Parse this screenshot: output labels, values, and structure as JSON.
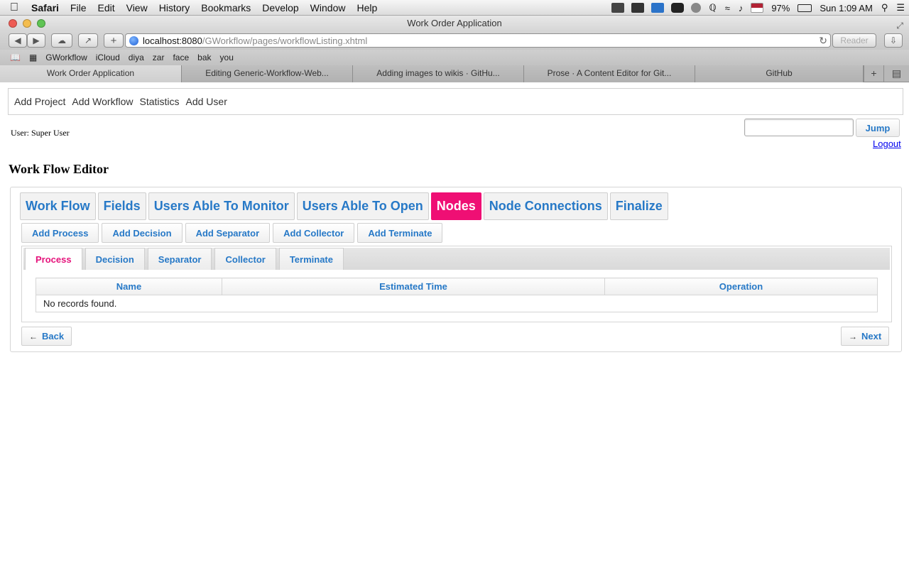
{
  "menubar": {
    "app": "Safari",
    "items": [
      "File",
      "Edit",
      "View",
      "History",
      "Bookmarks",
      "Develop",
      "Window",
      "Help"
    ],
    "battery": "97%",
    "clock": "Sun 1:09 AM"
  },
  "window": {
    "title": "Work Order Application"
  },
  "url": {
    "host": "localhost:8080",
    "path": "/GWorkflow/pages/workflowListing.xhtml",
    "reader": "Reader"
  },
  "bookmarks": [
    "GWorkflow",
    "iCloud",
    "diya",
    "zar",
    "face",
    "bak",
    "you"
  ],
  "tabs": [
    "Work Order Application",
    "Editing Generic-Workflow-Web...",
    "Adding images to wikis · GitHu...",
    "Prose · A Content Editor for Git...",
    "GitHub"
  ],
  "topmenu": [
    "Add Project",
    "Add Workflow",
    "Statistics",
    "Add User"
  ],
  "user_label": "User: Super User",
  "jump_label": "Jump",
  "logout_label": "Logout",
  "page_title": "Work Flow Editor",
  "steps": [
    "Work Flow",
    "Fields",
    "Users Able To Monitor",
    "Users Able To Open",
    "Nodes",
    "Node Connections",
    "Finalize"
  ],
  "actions": [
    "Add Process",
    "Add Decision",
    "Add Separator",
    "Add Collector",
    "Add Terminate"
  ],
  "node_tabs": [
    "Process",
    "Decision",
    "Separator",
    "Collector",
    "Terminate"
  ],
  "table": {
    "columns": [
      "Name",
      "Estimated Time",
      "Operation"
    ],
    "empty_message": "No records found."
  },
  "nav": {
    "back": "Back",
    "next": "Next"
  },
  "colors": {
    "accent": "#2779c7",
    "active": "#ef0f74"
  }
}
